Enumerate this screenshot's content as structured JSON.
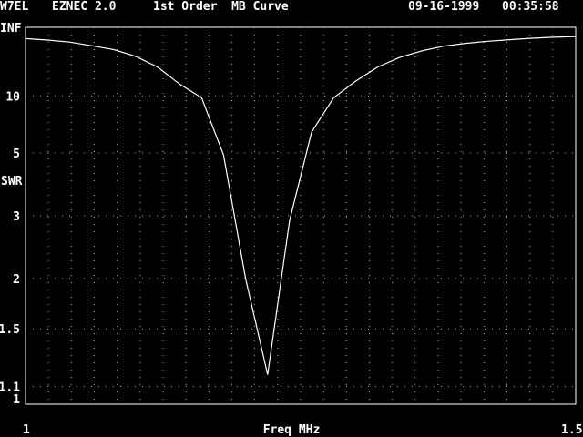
{
  "header": {
    "callsign": "W7EL",
    "program": "EZNEC 2.0",
    "plot_title": "1st Order  MB Curve",
    "date": "09-16-1999",
    "time": "00:35:58"
  },
  "chart_data": {
    "type": "line",
    "title": "1st Order  MB Curve",
    "xlabel": "Freq MHz",
    "ylabel": "SWR",
    "xlim": [
      1,
      1.5
    ],
    "x_tick_labels": [
      "1",
      "1.5"
    ],
    "y_tick_labels": [
      "INF",
      "10",
      "5",
      "3",
      "2",
      "1.5",
      "1.1",
      "1"
    ],
    "y_scale": "reflection coefficient (SWR-1)/(SWR+1)",
    "grid": true,
    "series": [
      {
        "x": [
          1.0,
          1.02,
          1.04,
          1.06,
          1.08,
          1.1,
          1.12,
          1.14,
          1.16,
          1.18,
          1.2,
          1.22,
          1.24,
          1.26,
          1.28,
          1.3,
          1.32,
          1.34,
          1.36,
          1.38,
          1.4,
          1.42,
          1.44,
          1.46,
          1.48,
          1.5
        ],
        "values": [
          66,
          58,
          50,
          40,
          33,
          25,
          18,
          12.3,
          9.7,
          4.9,
          2.0,
          1.17,
          2.9,
          6.2,
          9.7,
          13,
          18,
          24,
          31,
          39,
          46,
          53,
          60,
          68,
          75,
          80
        ]
      }
    ]
  }
}
